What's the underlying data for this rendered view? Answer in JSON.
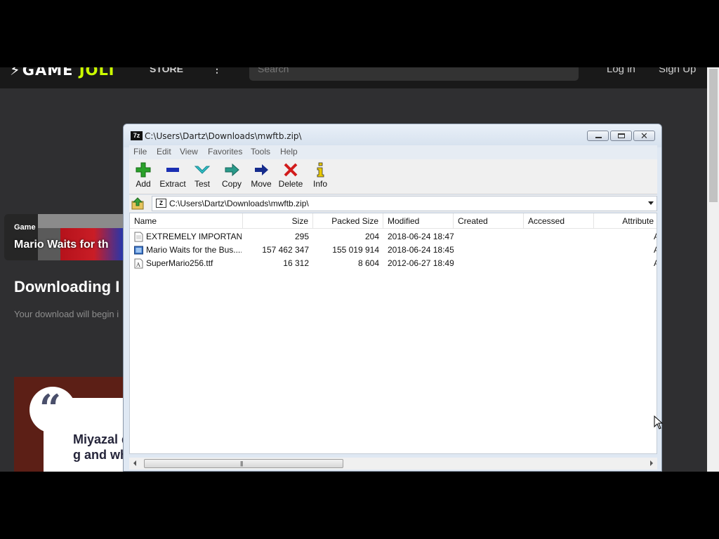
{
  "site": {
    "logo_text": "GAME",
    "logo_text2": "JOLT",
    "nav_store": "STORE",
    "nav_more": "⋮",
    "search_placeholder": "Search",
    "login": "Log in",
    "signup": "Sign Up",
    "game_card": {
      "type": "Game",
      "title": "Mario Waits for th"
    },
    "download_heading": "Downloading I",
    "download_sub": "Your download will begin i",
    "promo_quote": "“",
    "promo_text": "Miyazal doing g and wh"
  },
  "window": {
    "title": "C:\\Users\\Dartz\\Downloads\\mwftb.zip\\",
    "icon_label": "7z",
    "menu": [
      "File",
      "Edit",
      "View",
      "Favorites",
      "Tools",
      "Help"
    ],
    "toolbar": [
      {
        "label": "Add",
        "icon": "add-icon",
        "color": "#2aa12a"
      },
      {
        "label": "Extract",
        "icon": "extract-icon",
        "color": "#1b2fb3"
      },
      {
        "label": "Test",
        "icon": "test-icon",
        "color": "#30c0c8"
      },
      {
        "label": "Copy",
        "icon": "copy-icon",
        "color": "#2a9a8a"
      },
      {
        "label": "Move",
        "icon": "move-icon",
        "color": "#162c8c"
      },
      {
        "label": "Delete",
        "icon": "delete-icon",
        "color": "#d21c1c"
      },
      {
        "label": "Info",
        "icon": "info-icon",
        "color": "#e8c800"
      }
    ],
    "address": "C:\\Users\\Dartz\\Downloads\\mwftb.zip\\",
    "columns": [
      "Name",
      "Size",
      "Packed Size",
      "Modified",
      "Created",
      "Accessed",
      "Attribute"
    ],
    "files": [
      {
        "name": "EXTREMELY IMPORTAN...",
        "size": "295",
        "packed": "204",
        "modified": "2018-06-24 18:47",
        "created": "",
        "accessed": "",
        "attr": "A",
        "icon": "text-file-icon"
      },
      {
        "name": "Mario Waits for the Bus....",
        "size": "157 462 347",
        "packed": "155 019 914",
        "modified": "2018-06-24 18:45",
        "created": "",
        "accessed": "",
        "attr": "A",
        "icon": "video-file-icon"
      },
      {
        "name": "SuperMario256.ttf",
        "size": "16 312",
        "packed": "8 604",
        "modified": "2012-06-27 18:49",
        "created": "",
        "accessed": "",
        "attr": "A",
        "icon": "font-file-icon"
      }
    ],
    "scroll_grip": "|||"
  }
}
